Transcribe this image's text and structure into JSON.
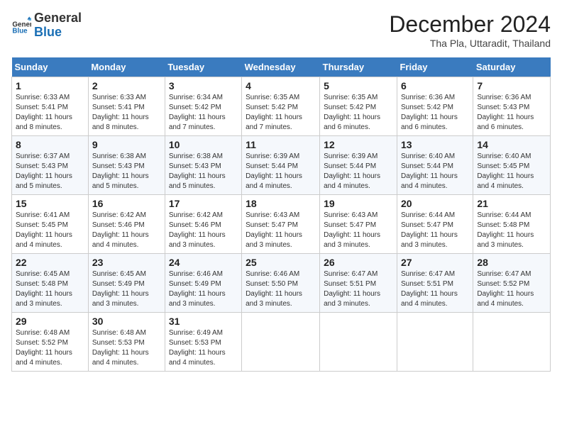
{
  "header": {
    "logo_general": "General",
    "logo_blue": "Blue",
    "month_title": "December 2024",
    "location": "Tha Pla, Uttaradit, Thailand"
  },
  "days_of_week": [
    "Sunday",
    "Monday",
    "Tuesday",
    "Wednesday",
    "Thursday",
    "Friday",
    "Saturday"
  ],
  "weeks": [
    [
      {
        "day": 1,
        "sunrise": "6:33 AM",
        "sunset": "5:41 PM",
        "daylight": "11 hours and 8 minutes."
      },
      {
        "day": 2,
        "sunrise": "6:33 AM",
        "sunset": "5:41 PM",
        "daylight": "11 hours and 8 minutes."
      },
      {
        "day": 3,
        "sunrise": "6:34 AM",
        "sunset": "5:42 PM",
        "daylight": "11 hours and 7 minutes."
      },
      {
        "day": 4,
        "sunrise": "6:35 AM",
        "sunset": "5:42 PM",
        "daylight": "11 hours and 7 minutes."
      },
      {
        "day": 5,
        "sunrise": "6:35 AM",
        "sunset": "5:42 PM",
        "daylight": "11 hours and 6 minutes."
      },
      {
        "day": 6,
        "sunrise": "6:36 AM",
        "sunset": "5:42 PM",
        "daylight": "11 hours and 6 minutes."
      },
      {
        "day": 7,
        "sunrise": "6:36 AM",
        "sunset": "5:43 PM",
        "daylight": "11 hours and 6 minutes."
      }
    ],
    [
      {
        "day": 8,
        "sunrise": "6:37 AM",
        "sunset": "5:43 PM",
        "daylight": "11 hours and 5 minutes."
      },
      {
        "day": 9,
        "sunrise": "6:38 AM",
        "sunset": "5:43 PM",
        "daylight": "11 hours and 5 minutes."
      },
      {
        "day": 10,
        "sunrise": "6:38 AM",
        "sunset": "5:43 PM",
        "daylight": "11 hours and 5 minutes."
      },
      {
        "day": 11,
        "sunrise": "6:39 AM",
        "sunset": "5:44 PM",
        "daylight": "11 hours and 4 minutes."
      },
      {
        "day": 12,
        "sunrise": "6:39 AM",
        "sunset": "5:44 PM",
        "daylight": "11 hours and 4 minutes."
      },
      {
        "day": 13,
        "sunrise": "6:40 AM",
        "sunset": "5:44 PM",
        "daylight": "11 hours and 4 minutes."
      },
      {
        "day": 14,
        "sunrise": "6:40 AM",
        "sunset": "5:45 PM",
        "daylight": "11 hours and 4 minutes."
      }
    ],
    [
      {
        "day": 15,
        "sunrise": "6:41 AM",
        "sunset": "5:45 PM",
        "daylight": "11 hours and 4 minutes."
      },
      {
        "day": 16,
        "sunrise": "6:42 AM",
        "sunset": "5:46 PM",
        "daylight": "11 hours and 4 minutes."
      },
      {
        "day": 17,
        "sunrise": "6:42 AM",
        "sunset": "5:46 PM",
        "daylight": "11 hours and 3 minutes."
      },
      {
        "day": 18,
        "sunrise": "6:43 AM",
        "sunset": "5:47 PM",
        "daylight": "11 hours and 3 minutes."
      },
      {
        "day": 19,
        "sunrise": "6:43 AM",
        "sunset": "5:47 PM",
        "daylight": "11 hours and 3 minutes."
      },
      {
        "day": 20,
        "sunrise": "6:44 AM",
        "sunset": "5:47 PM",
        "daylight": "11 hours and 3 minutes."
      },
      {
        "day": 21,
        "sunrise": "6:44 AM",
        "sunset": "5:48 PM",
        "daylight": "11 hours and 3 minutes."
      }
    ],
    [
      {
        "day": 22,
        "sunrise": "6:45 AM",
        "sunset": "5:48 PM",
        "daylight": "11 hours and 3 minutes."
      },
      {
        "day": 23,
        "sunrise": "6:45 AM",
        "sunset": "5:49 PM",
        "daylight": "11 hours and 3 minutes."
      },
      {
        "day": 24,
        "sunrise": "6:46 AM",
        "sunset": "5:49 PM",
        "daylight": "11 hours and 3 minutes."
      },
      {
        "day": 25,
        "sunrise": "6:46 AM",
        "sunset": "5:50 PM",
        "daylight": "11 hours and 3 minutes."
      },
      {
        "day": 26,
        "sunrise": "6:47 AM",
        "sunset": "5:51 PM",
        "daylight": "11 hours and 3 minutes."
      },
      {
        "day": 27,
        "sunrise": "6:47 AM",
        "sunset": "5:51 PM",
        "daylight": "11 hours and 4 minutes."
      },
      {
        "day": 28,
        "sunrise": "6:47 AM",
        "sunset": "5:52 PM",
        "daylight": "11 hours and 4 minutes."
      }
    ],
    [
      {
        "day": 29,
        "sunrise": "6:48 AM",
        "sunset": "5:52 PM",
        "daylight": "11 hours and 4 minutes."
      },
      {
        "day": 30,
        "sunrise": "6:48 AM",
        "sunset": "5:53 PM",
        "daylight": "11 hours and 4 minutes."
      },
      {
        "day": 31,
        "sunrise": "6:49 AM",
        "sunset": "5:53 PM",
        "daylight": "11 hours and 4 minutes."
      },
      null,
      null,
      null,
      null
    ]
  ]
}
